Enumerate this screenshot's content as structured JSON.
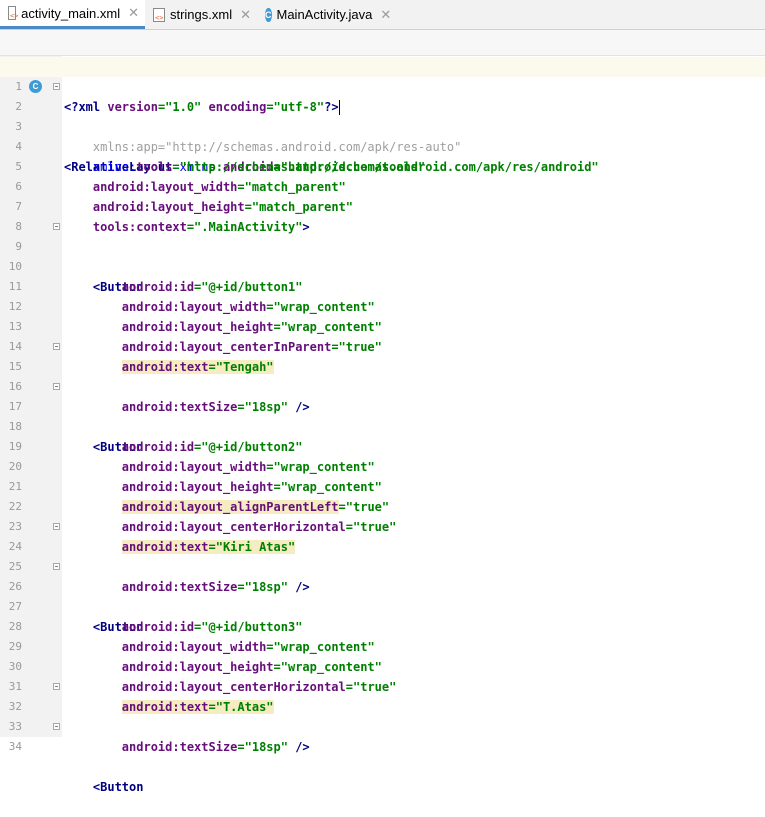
{
  "tabs": [
    {
      "label": "activity_main.xml",
      "icon": "xml-file-icon",
      "active": true
    },
    {
      "label": "strings.xml",
      "icon": "xml-file-icon",
      "active": false
    },
    {
      "label": "MainActivity.java",
      "icon": "java-class-icon",
      "active": false
    }
  ],
  "lines": [
    {
      "n": "1",
      "code": "<?xml version=\"1.0\" encoding=\"utf-8\"?>"
    },
    {
      "n": "2",
      "code": "<RelativeLayout xmlns:android=\"http://schemas.android.com/apk/res/android\""
    },
    {
      "n": "3",
      "code": "    xmlns:app=\"http://schemas.android.com/apk/res-auto\""
    },
    {
      "n": "4",
      "code": "    xmlns:tools=\"http://schemas.android.com/tools\""
    },
    {
      "n": "5",
      "code": "    android:layout_width=\"match_parent\""
    },
    {
      "n": "6",
      "code": "    android:layout_height=\"match_parent\""
    },
    {
      "n": "7",
      "code": "    tools:context=\".MainActivity\">"
    },
    {
      "n": "8",
      "code": ""
    },
    {
      "n": "9",
      "code": "    <Button"
    },
    {
      "n": "10",
      "code": "        android:id=\"@+id/button1\""
    },
    {
      "n": "11",
      "code": "        android:layout_width=\"wrap_content\""
    },
    {
      "n": "12",
      "code": "        android:layout_height=\"wrap_content\""
    },
    {
      "n": "13",
      "code": "        android:layout_centerInParent=\"true\""
    },
    {
      "n": "14",
      "code": "        android:text=\"Tengah\""
    },
    {
      "n": "15",
      "code": "        android:textSize=\"18sp\" />"
    },
    {
      "n": "16",
      "code": ""
    },
    {
      "n": "17",
      "code": "    <Button"
    },
    {
      "n": "18",
      "code": "        android:id=\"@+id/button2\""
    },
    {
      "n": "19",
      "code": "        android:layout_width=\"wrap_content\""
    },
    {
      "n": "20",
      "code": "        android:layout_height=\"wrap_content\""
    },
    {
      "n": "21",
      "code": "        android:layout_alignParentLeft=\"true\""
    },
    {
      "n": "22",
      "code": "        android:layout_centerHorizontal=\"true\""
    },
    {
      "n": "23",
      "code": "        android:text=\"Kiri Atas\""
    },
    {
      "n": "24",
      "code": "        android:textSize=\"18sp\" />"
    },
    {
      "n": "25",
      "code": ""
    },
    {
      "n": "26",
      "code": "    <Button"
    },
    {
      "n": "27",
      "code": "        android:id=\"@+id/button3\""
    },
    {
      "n": "28",
      "code": "        android:layout_width=\"wrap_content\""
    },
    {
      "n": "29",
      "code": "        android:layout_height=\"wrap_content\""
    },
    {
      "n": "30",
      "code": "        android:layout_centerHorizontal=\"true\""
    },
    {
      "n": "31",
      "code": "        android:text=\"T.Atas\""
    },
    {
      "n": "32",
      "code": "        android:textSize=\"18sp\" />"
    },
    {
      "n": "33",
      "code": ""
    },
    {
      "n": "34",
      "code": "    <Button"
    }
  ],
  "colors": {
    "tag": "#000080",
    "attribute": "#660e7a",
    "namespace_attribute": "#0000ff",
    "value": "#008000",
    "highlight": "#f5ecc1",
    "gutter": "#f2f2f2"
  }
}
